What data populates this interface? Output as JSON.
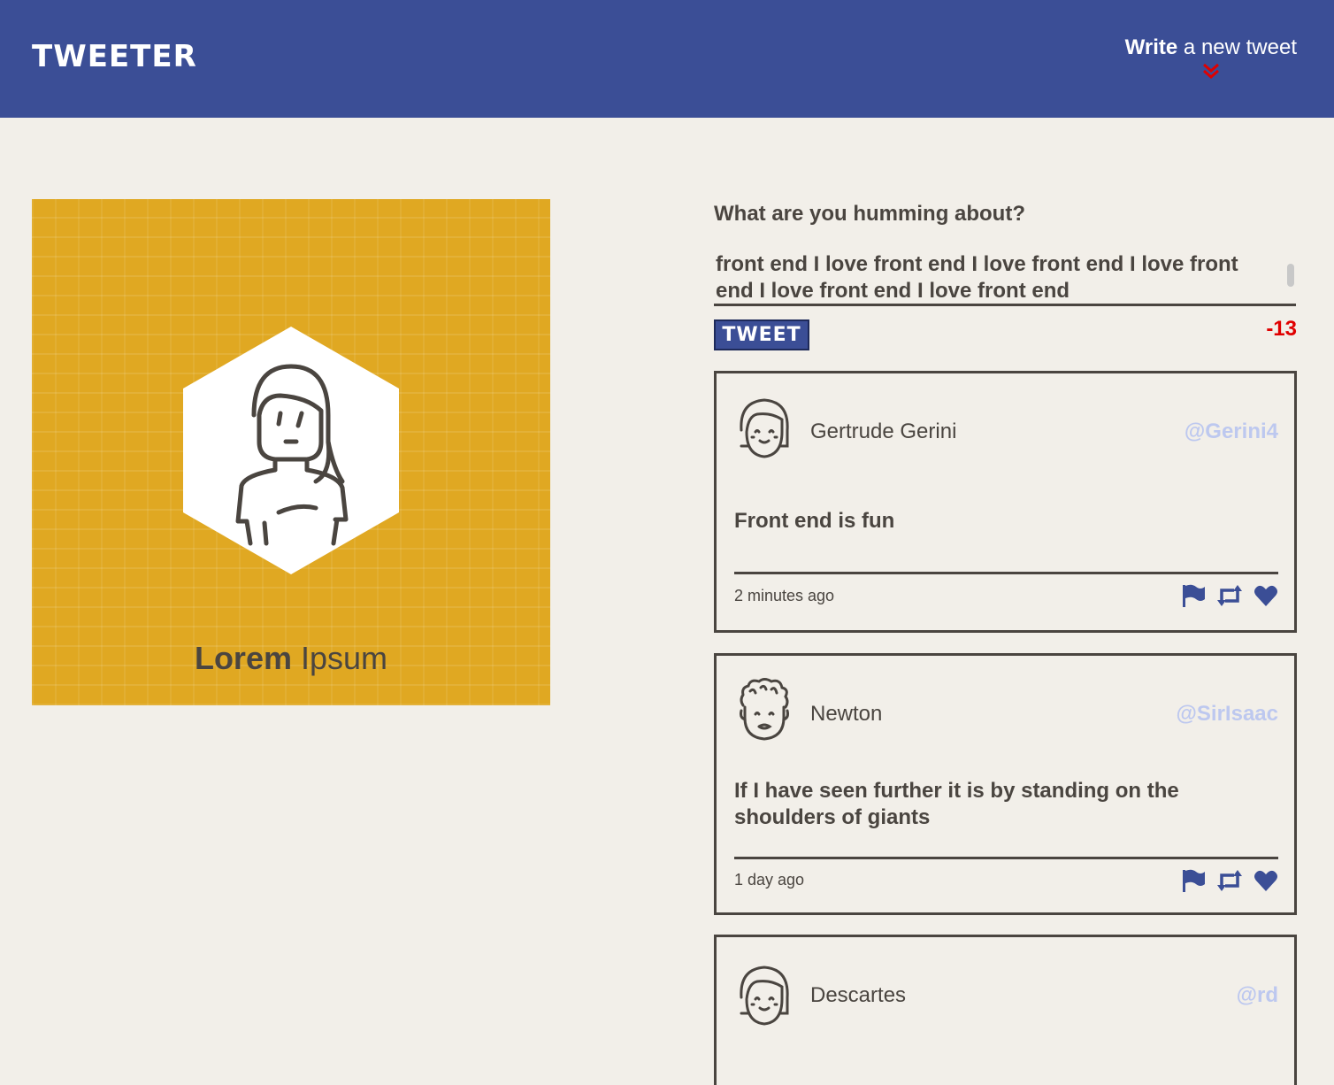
{
  "nav": {
    "brand": "TWEETER",
    "compose_bold": "Write",
    "compose_rest": "a new tweet"
  },
  "profile": {
    "first_name": "Lorem",
    "last_name": "Ipsum",
    "background_color": "#e0a822"
  },
  "composer": {
    "prompt": "What are you humming about?",
    "text": "front end I love front end I love front end I love front end I love front end I love front end ",
    "button_label": "TWEET",
    "counter": "-13"
  },
  "tweets": [
    {
      "name": "Gertrude Gerini",
      "handle": "@Gerini4",
      "body": "Front end is fun",
      "time": "2 minutes ago",
      "avatar": "girl-avatar"
    },
    {
      "name": "Newton",
      "handle": "@SirIsaac",
      "body": "If I have seen further it is by standing on the shoulders of giants",
      "time": "1 day ago",
      "avatar": "curly-hair-avatar"
    },
    {
      "name": "Descartes",
      "handle": "@rd",
      "avatar": "girl-avatar"
    }
  ],
  "colors": {
    "nav": "#3b4e96",
    "background": "#f2efe9",
    "accent_red": "#e00000",
    "handle": "#bdc8ef",
    "text": "#4a4540"
  },
  "icons": [
    "flag-icon",
    "retweet-icon",
    "heart-icon",
    "chevron-double-down-icon"
  ]
}
